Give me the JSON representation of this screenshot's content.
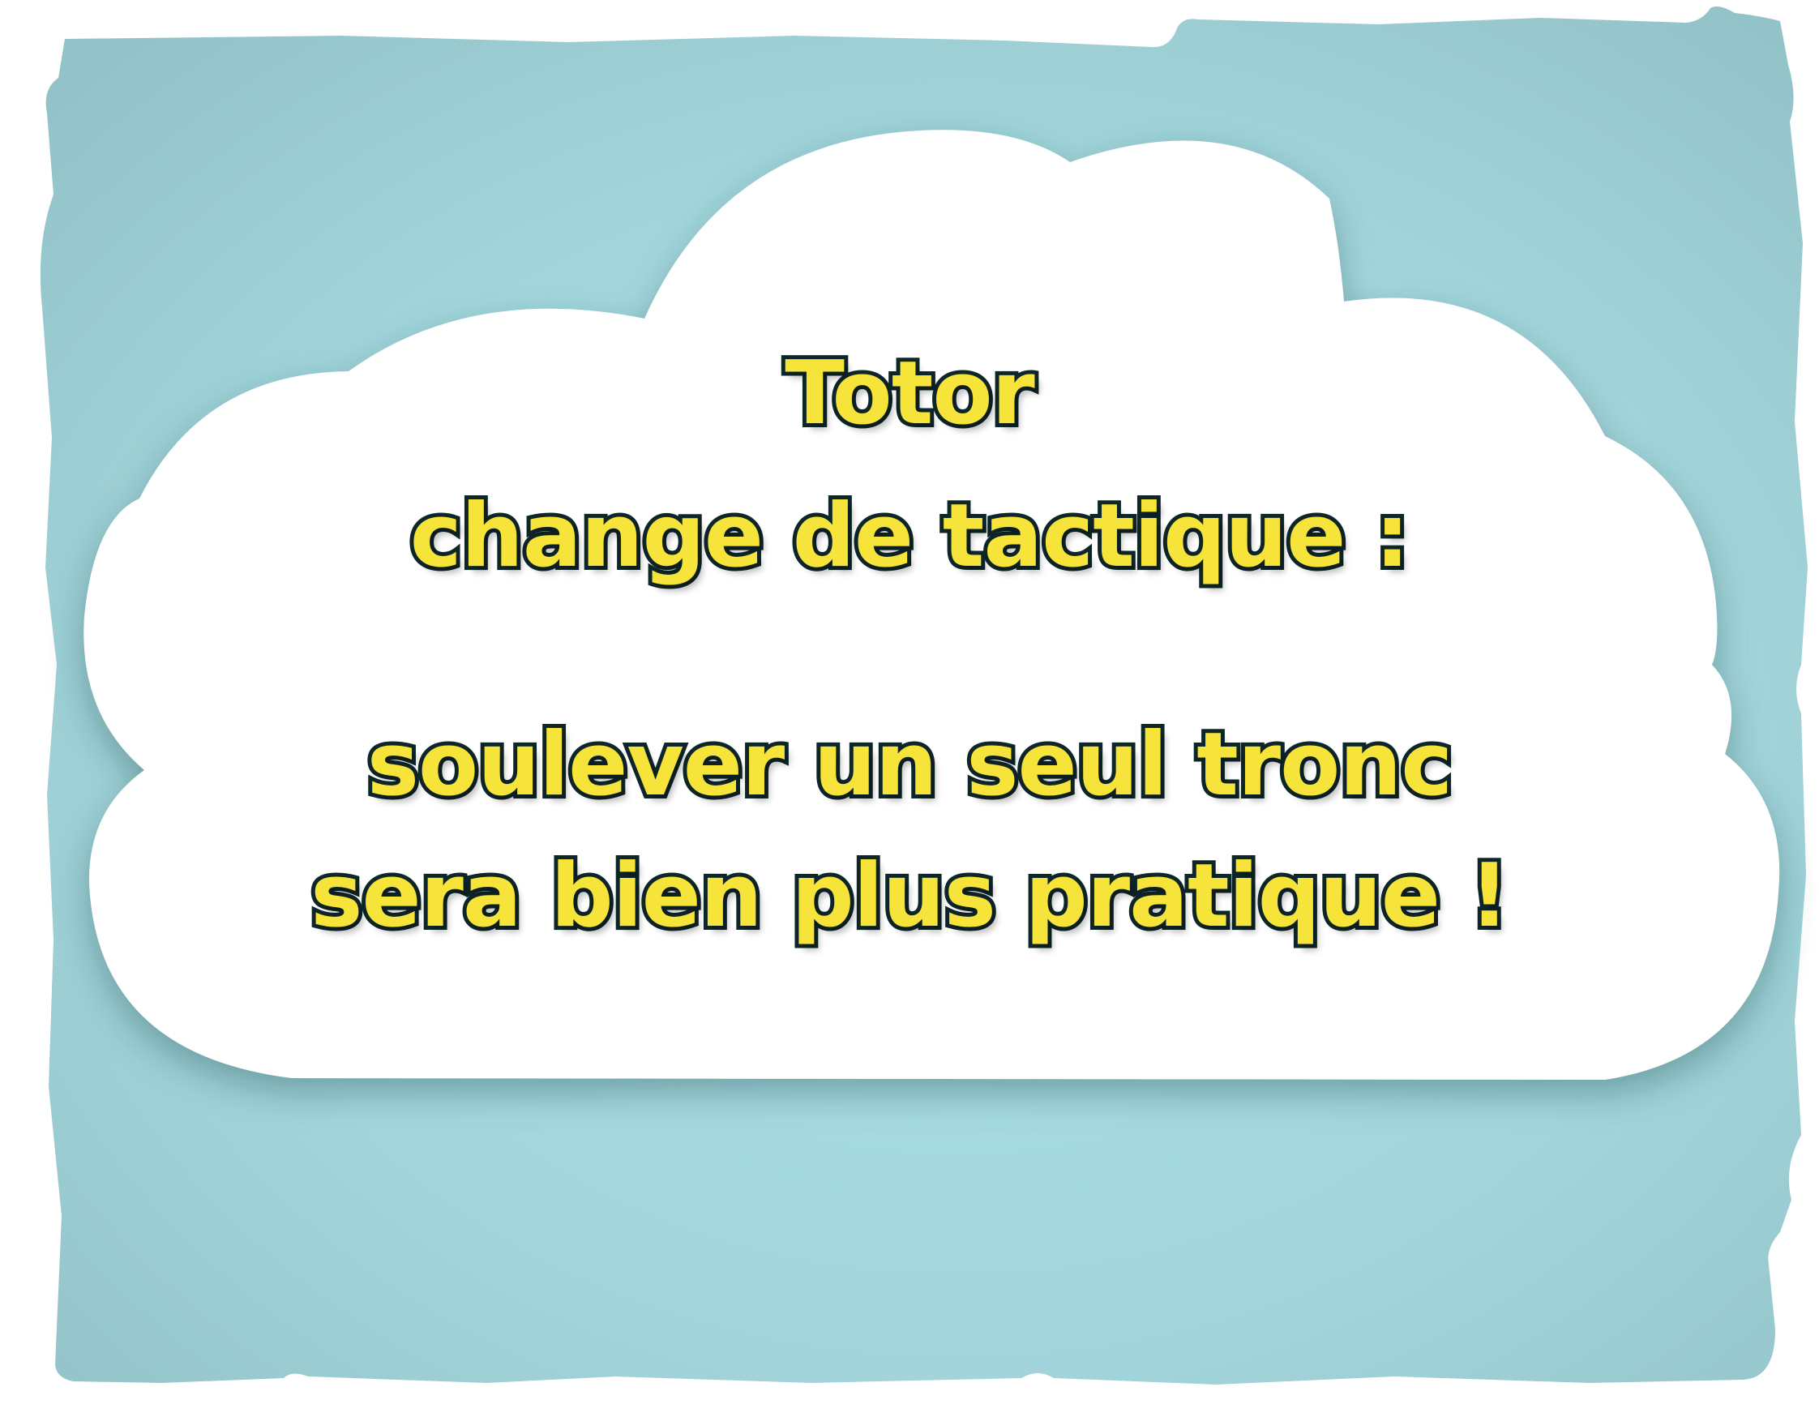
{
  "colors": {
    "background_panel": "#9ccbd0",
    "background_glow": "#a9e0e7",
    "cloud": "#ffffff",
    "text_fill": "#f7e43a",
    "text_outline": "#0f2628"
  },
  "caption": {
    "line1": "Totor",
    "line2": "change de tactique :",
    "line3": "soulever un seul tronc",
    "line4": "sera bien plus pratique !"
  }
}
